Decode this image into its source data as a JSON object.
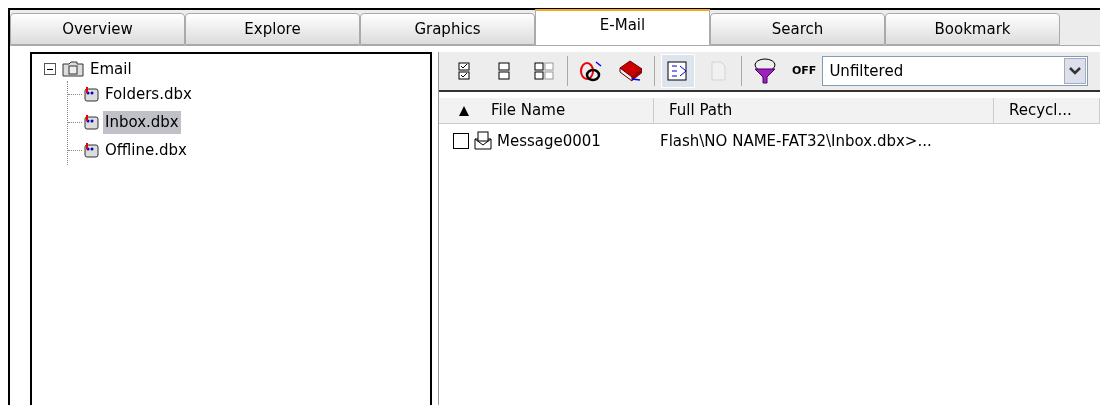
{
  "tabs": [
    {
      "label": "Overview",
      "selected": false
    },
    {
      "label": "Explore",
      "selected": false
    },
    {
      "label": "Graphics",
      "selected": false
    },
    {
      "label": "E-Mail",
      "selected": true
    },
    {
      "label": "Search",
      "selected": false
    },
    {
      "label": "Bookmark",
      "selected": false
    }
  ],
  "tree": {
    "label": "Email",
    "expanded": true,
    "children": [
      {
        "label": "Folders.dbx",
        "selected": false
      },
      {
        "label": "Inbox.dbx",
        "selected": true
      },
      {
        "label": "Offline.dbx",
        "selected": false
      }
    ]
  },
  "toolbar": [
    {
      "kind": "check-all",
      "pressed": false,
      "disabled": false
    },
    {
      "kind": "uncheck-all",
      "pressed": false,
      "disabled": false
    },
    {
      "kind": "grid",
      "pressed": false,
      "disabled": false
    },
    {
      "kind": "sep"
    },
    {
      "kind": "font",
      "pressed": false,
      "disabled": false
    },
    {
      "kind": "book",
      "pressed": false,
      "disabled": false
    },
    {
      "kind": "sep"
    },
    {
      "kind": "tree-view",
      "pressed": true,
      "disabled": false
    },
    {
      "kind": "page",
      "pressed": false,
      "disabled": true
    },
    {
      "kind": "sep"
    },
    {
      "kind": "filter",
      "pressed": false,
      "disabled": false
    }
  ],
  "filter_state": "OFF",
  "filter_select": {
    "value": "Unfiltered"
  },
  "table": {
    "columns": [
      {
        "label": "File Name",
        "sorted": true
      },
      {
        "label": "Full Path",
        "sorted": false
      },
      {
        "label": "Recycl...",
        "sorted": false
      }
    ],
    "rows": [
      {
        "checked": false,
        "file_name": "Message0001",
        "full_path": "Flash\\NO NAME-FAT32\\Inbox.dbx>..."
      }
    ]
  }
}
